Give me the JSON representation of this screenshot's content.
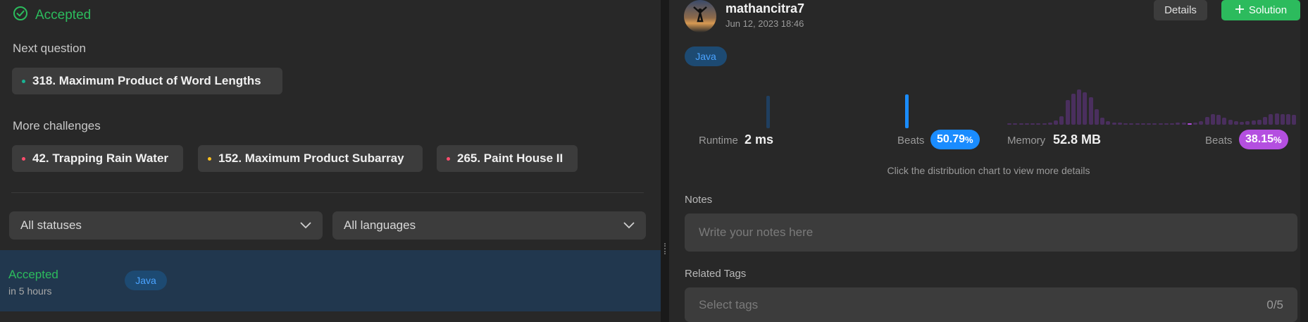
{
  "left": {
    "accepted_title": "Accepted",
    "next_question_label": "Next question",
    "next_question": {
      "title": "318. Maximum Product of Word Lengths",
      "dot_color": "#1ab394"
    },
    "more_challenges_label": "More challenges",
    "challenges": [
      {
        "title": "42. Trapping Rain Water",
        "dot_color": "#ff4d6d"
      },
      {
        "title": "152. Maximum Product Subarray",
        "dot_color": "#ffc01e"
      },
      {
        "title": "265. Paint House II",
        "dot_color": "#ff4d6d"
      }
    ],
    "filters": {
      "status": "All statuses",
      "language": "All languages"
    },
    "submission": {
      "status": "Accepted",
      "time": "in 5 hours",
      "language": "Java"
    }
  },
  "right": {
    "user": {
      "name": "mathancitra7",
      "date": "Jun 12, 2023 18:46"
    },
    "buttons": {
      "details": "Details",
      "solution": "Solution"
    },
    "language": "Java",
    "runtime": {
      "label": "Runtime",
      "value": "2 ms",
      "beats_label": "Beats",
      "beats": "50.79",
      "beats_suffix": "%",
      "color": "#1a8cff"
    },
    "memory": {
      "label": "Memory",
      "value": "52.8 MB",
      "beats_label": "Beats",
      "beats": "38.15",
      "beats_suffix": "%",
      "color": "#b44fe0"
    },
    "hint": "Click the distribution chart to view more details",
    "notes": {
      "label": "Notes",
      "placeholder": "Write your notes here"
    },
    "tags": {
      "label": "Related Tags",
      "placeholder": "Select tags",
      "count": "0/5"
    }
  },
  "chart_data": [
    {
      "type": "bar",
      "name": "runtime-distribution",
      "values": [
        0.95,
        1.0
      ],
      "highlight_index": 1
    },
    {
      "type": "bar",
      "name": "memory-distribution",
      "values": [
        0.04,
        0.04,
        0.04,
        0.04,
        0.04,
        0.04,
        0.05,
        0.07,
        0.12,
        0.25,
        0.7,
        0.88,
        1.0,
        0.92,
        0.78,
        0.45,
        0.2,
        0.1,
        0.07,
        0.06,
        0.05,
        0.05,
        0.05,
        0.04,
        0.05,
        0.05,
        0.05,
        0.05,
        0.05,
        0.06,
        0.06,
        0.05,
        0.06,
        0.1,
        0.22,
        0.3,
        0.28,
        0.2,
        0.15,
        0.1,
        0.08,
        0.1,
        0.12,
        0.15,
        0.22,
        0.3,
        0.33,
        0.3,
        0.3,
        0.28
      ],
      "highlight_index": 31
    }
  ]
}
